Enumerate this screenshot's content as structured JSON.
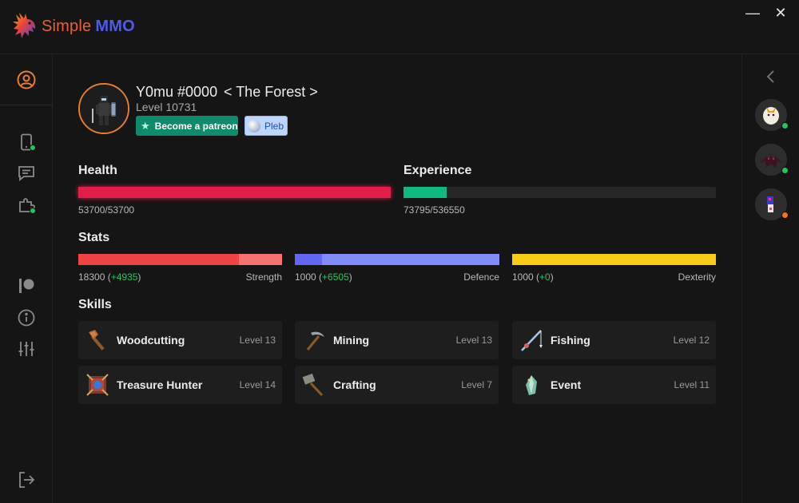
{
  "app": {
    "name_part1": "Simple",
    "name_part2": "MMO"
  },
  "window": {
    "minimize": "—",
    "close": "✕"
  },
  "player": {
    "name": "Y0mu #0000",
    "location": "< The Forest >",
    "level": "Level 10731",
    "patreon_button": "Become a patreon",
    "rank_badge": "Pleb"
  },
  "health": {
    "label": "Health",
    "text": "53700/53700",
    "current": 53700,
    "max": 53700,
    "color": "#e11d48"
  },
  "experience": {
    "label": "Experience",
    "text": "73795/536550",
    "current": 73795,
    "max": 536550,
    "color": "#10b981"
  },
  "stats": {
    "label": "Stats",
    "items": [
      {
        "name": "Strength",
        "base": "18300",
        "bonus": "+4935",
        "base_fraction": 0.787,
        "color": "#ef4444",
        "bonus_color": "#f87171"
      },
      {
        "name": "Defence",
        "base": "1000",
        "bonus": "+6505",
        "base_fraction": 0.133,
        "color": "#6366f1",
        "bonus_color": "#818cf8"
      },
      {
        "name": "Dexterity",
        "base": "1000",
        "bonus": "+0",
        "base_fraction": 1.0,
        "color": "#facc15",
        "bonus_color": "#facc15"
      }
    ]
  },
  "skills": {
    "label": "Skills",
    "items": [
      {
        "name": "Woodcutting",
        "level": "Level 13",
        "icon": "axe-icon"
      },
      {
        "name": "Mining",
        "level": "Level 13",
        "icon": "pickaxe-icon"
      },
      {
        "name": "Fishing",
        "level": "Level 12",
        "icon": "fishing-rod-icon"
      },
      {
        "name": "Treasure Hunter",
        "level": "Level 14",
        "icon": "treasure-map-icon"
      },
      {
        "name": "Crafting",
        "level": "Level 7",
        "icon": "hammer-icon"
      },
      {
        "name": "Event",
        "level": "Level 11",
        "icon": "crystal-icon"
      }
    ]
  },
  "colors": {
    "accent": "#e87d2c",
    "online": "#22c55e",
    "away": "#f97316"
  }
}
